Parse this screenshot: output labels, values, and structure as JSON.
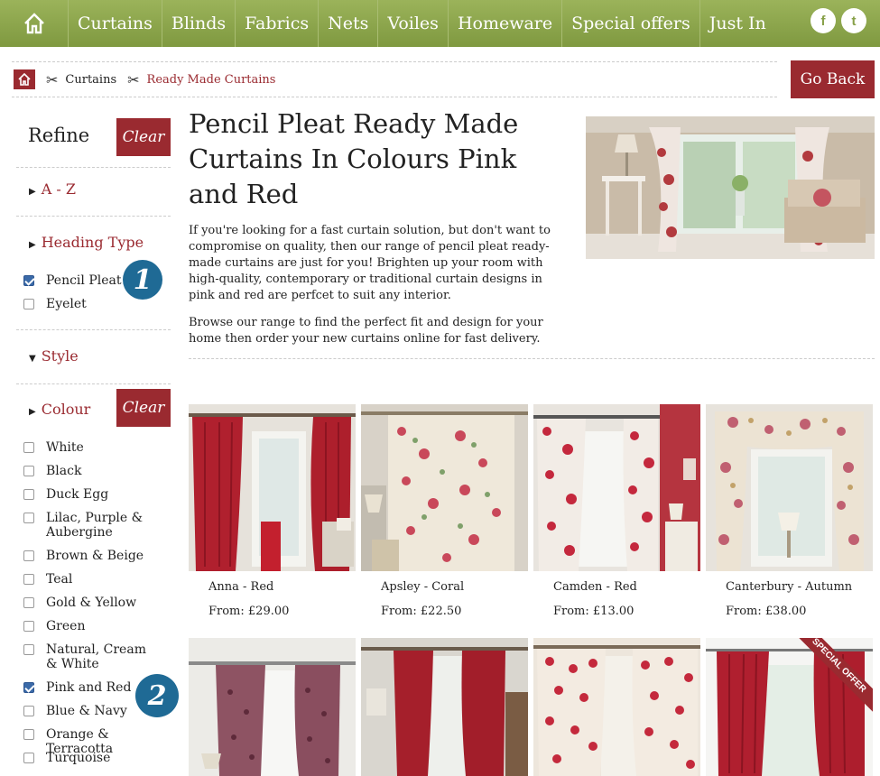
{
  "nav": {
    "items": [
      "Curtains",
      "Blinds",
      "Fabrics",
      "Nets",
      "Voiles",
      "Homeware",
      "Special offers",
      "Just In"
    ],
    "social": [
      "f",
      "t"
    ]
  },
  "breadcrumb": {
    "items": [
      "Curtains",
      "Ready Made Curtains"
    ]
  },
  "go_back": "Go Back",
  "sidebar": {
    "refine": "Refine",
    "clear": "Clear",
    "az": "A - Z",
    "heading_type": "Heading Type",
    "heading_options": [
      {
        "label": "Pencil Pleat",
        "checked": true
      },
      {
        "label": "Eyelet",
        "checked": false
      }
    ],
    "style": "Style",
    "colour": "Colour",
    "colour_options": [
      {
        "label": "White",
        "checked": false
      },
      {
        "label": "Black",
        "checked": false
      },
      {
        "label": "Duck Egg",
        "checked": false
      },
      {
        "label": "Lilac, Purple & Aubergine",
        "checked": false
      },
      {
        "label": "Brown & Beige",
        "checked": false
      },
      {
        "label": "Teal",
        "checked": false
      },
      {
        "label": "Gold & Yellow",
        "checked": false
      },
      {
        "label": "Green",
        "checked": false
      },
      {
        "label": "Natural, Cream & White",
        "checked": false
      },
      {
        "label": "Pink and Red",
        "checked": true
      },
      {
        "label": "Blue & Navy",
        "checked": false
      },
      {
        "label": "Orange & Terracotta",
        "checked": false
      },
      {
        "label": "Turquoise",
        "checked": false
      }
    ],
    "badges": [
      "1",
      "2"
    ]
  },
  "main": {
    "title": "Pencil Pleat Ready Made Curtains In Colours Pink and Red",
    "intro_p1": "If you're looking for a fast curtain solution, but don't want to compromise on quality, then our  range of pencil pleat ready-made curtains are just for you! Brighten up your room with high-quality, contemporary or traditional curtain designs in pink and red are perfcet to suit any interior.",
    "intro_p2": "Browse our  range to find the perfect fit and design for your home then order your new curtains online for fast delivery."
  },
  "products": [
    {
      "name": "Anna - Red",
      "price": "From: £29.00",
      "style": "plain"
    },
    {
      "name": "Apsley - Coral",
      "price": "From: £22.50",
      "style": "floral-cream"
    },
    {
      "name": "Camden - Red",
      "price": "From: £13.00",
      "style": "floral-red"
    },
    {
      "name": "Canterbury - Autumn",
      "price": "From: £38.00",
      "style": "floral-autumn"
    }
  ],
  "special_offer": "SPECIAL OFFER",
  "colors": {
    "brand_red": "#9a2a30",
    "nav_green": "#87a048",
    "badge_blue": "#1f6a95"
  }
}
